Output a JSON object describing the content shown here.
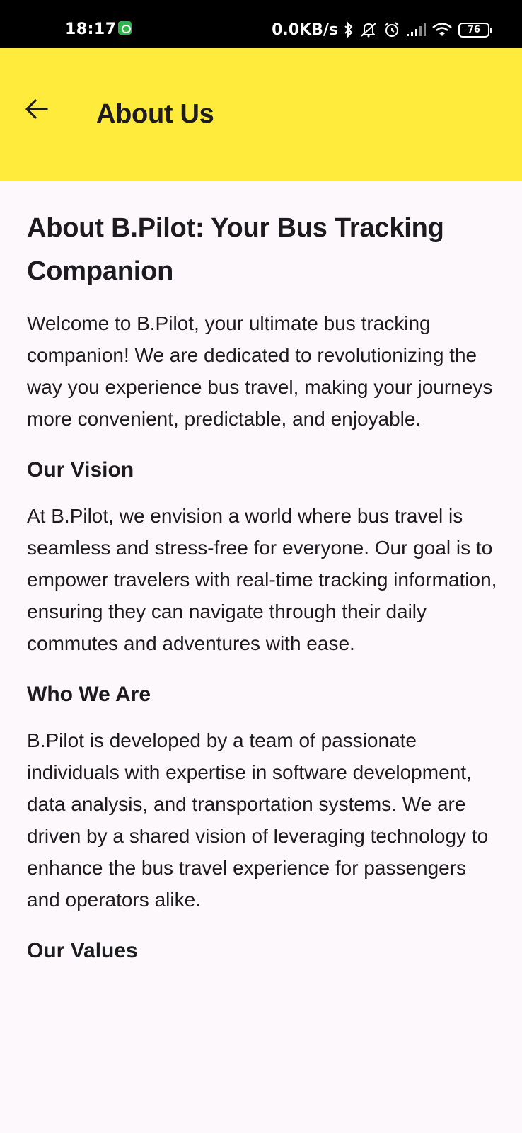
{
  "status_bar": {
    "time": "18:17",
    "net_speed": "0.0KB/s",
    "battery": "76",
    "icons": [
      "app-notification-icon",
      "bluetooth-icon",
      "mute-icon",
      "alarm-icon",
      "signal-icon",
      "wifi-icon",
      "battery-icon"
    ]
  },
  "app_bar": {
    "title": "About Us",
    "background": "#ffeb3b",
    "back_icon": "arrow-back-icon"
  },
  "content": {
    "heading": "About B.Pilot: Your Bus Tracking Companion",
    "intro": "Welcome to B.Pilot, your ultimate bus tracking companion! We are dedicated to revolutionizing the way you experience bus travel, making your journeys more convenient, predictable, and enjoyable.",
    "sections": [
      {
        "title": "Our Vision",
        "text": "At B.Pilot, we envision a world where bus travel is seamless and stress-free for everyone. Our goal is to empower travelers with real-time tracking information, ensuring they can navigate through their daily commutes and adventures with ease."
      },
      {
        "title": "Who We Are",
        "text": "B.Pilot is developed by a team of passionate individuals with expertise in software development, data analysis, and transportation systems. We are driven by a shared vision of leveraging technology to enhance the bus travel experience for passengers and operators alike."
      },
      {
        "title": "Our Values",
        "text": ""
      }
    ]
  }
}
